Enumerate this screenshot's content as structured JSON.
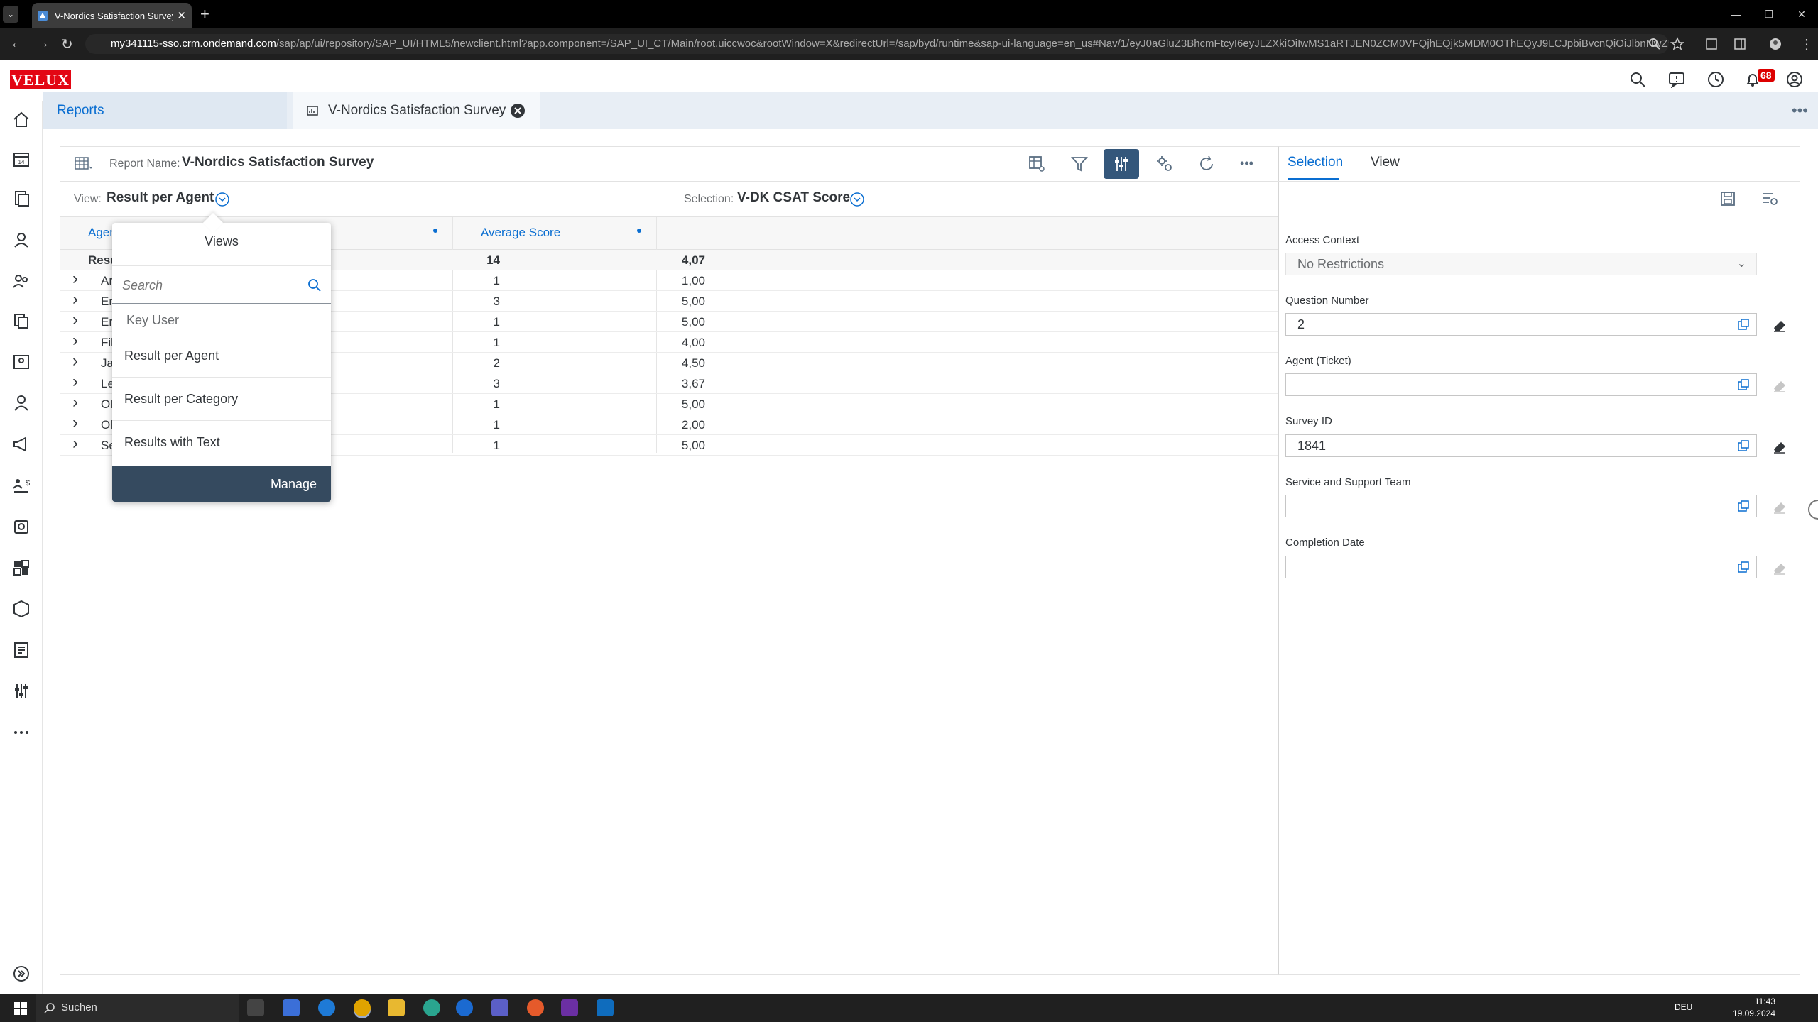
{
  "browser": {
    "tab_title": "V-Nordics Satisfaction Survey",
    "tab_close": "✕",
    "new_tab": "+",
    "url_host": "my341115-sso.crm.ondemand.com",
    "url_rest": "/sap/ap/ui/repository/SAP_UI/HTML5/newclient.html?app.component=/SAP_UI_CT/Main/root.uiccwoc&rootWindow=X&redirectUrl=/sap/byd/runtime&sap-ui-language=en_us#Nav/1/eyJ0aGluZ3BhcmFtcyI6eyJLZXkiOiIwMS1aRTJEN0ZCM0VFQjhEQjk5MDM0OThEQyJ9LCJpbiBvcnQiOiJlbnNwZWN0IiwidGFyZ2V0Il..."
  },
  "app": {
    "logo": "VELUX",
    "notifications_count": "68"
  },
  "tabs": {
    "reports": "Reports",
    "survey": "V-Nordics Satisfaction Survey",
    "more": "•••"
  },
  "toolbar": {
    "report_name_label": "Report Name:",
    "report_name": "V-Nordics Satisfaction Survey",
    "more": "•••"
  },
  "view": {
    "label": "View:",
    "value": "Result per Agent"
  },
  "selection": {
    "label": "Selection:",
    "value": "V-DK CSAT Score"
  },
  "table": {
    "headers": {
      "agent": "Agen",
      "count": "",
      "average": "Average Score"
    },
    "result_row": {
      "label": "Resu",
      "count": "14",
      "average": "4,07"
    },
    "rows": [
      {
        "name": "Ar",
        "count": "1",
        "average": "1,00"
      },
      {
        "name": "Er",
        "count": "3",
        "average": "5,00"
      },
      {
        "name": "Er",
        "count": "1",
        "average": "5,00"
      },
      {
        "name": "Fil",
        "count": "1",
        "average": "4,00"
      },
      {
        "name": "Ja",
        "count": "2",
        "average": "4,50"
      },
      {
        "name": "Le",
        "count": "3",
        "average": "3,67"
      },
      {
        "name": "Ol",
        "count": "1",
        "average": "5,00"
      },
      {
        "name": "Ol",
        "count": "1",
        "average": "2,00"
      },
      {
        "name": "Se",
        "count": "1",
        "average": "5,00"
      }
    ]
  },
  "views_popover": {
    "title": "Views",
    "search_placeholder": "Search",
    "group": "Key User",
    "items": [
      "Result per Agent",
      "Result per Category",
      "Results with Text"
    ],
    "manage": "Manage"
  },
  "right_panel": {
    "tabs": [
      "Selection",
      "View"
    ],
    "fields": [
      {
        "label": "Access Context",
        "value": "No Restrictions"
      },
      {
        "label": "Question Number",
        "value": "2"
      },
      {
        "label": "Agent (Ticket)",
        "value": ""
      },
      {
        "label": "Survey ID",
        "value": "1841"
      },
      {
        "label": "Service and Support Team",
        "value": ""
      },
      {
        "label": "Completion Date",
        "value": ""
      }
    ]
  },
  "taskbar": {
    "search": "Suchen",
    "lang": "DEU",
    "time": "11:43",
    "date": "19.09.2024"
  },
  "colors": {
    "brand": "#e30613",
    "accent": "#0a6ed1",
    "active_button": "#34577b",
    "manage_bg": "#354a5f"
  }
}
